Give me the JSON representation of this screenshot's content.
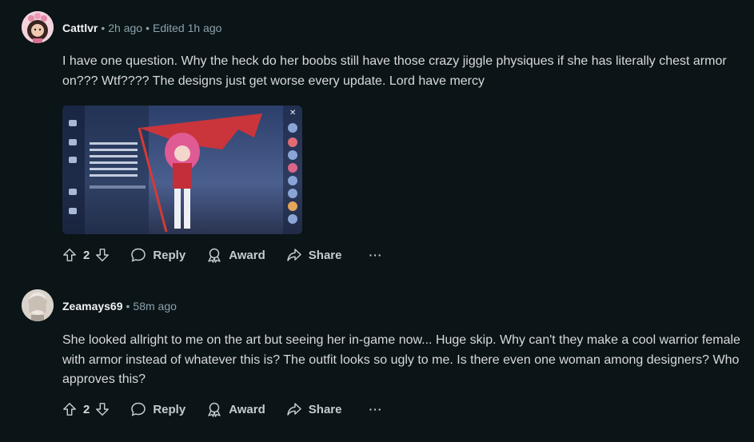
{
  "comments": [
    {
      "author": "Cattlvr",
      "time": "2h ago",
      "edited": "Edited 1h ago",
      "body": "I have one question. Why the heck do her boobs still have those crazy jiggle physiques if she has literally chest armor on??? Wtf???? The designs just get worse every update. Lord have mercy",
      "votes": "2",
      "actions": {
        "reply": "Reply",
        "award": "Award",
        "share": "Share",
        "more": "···"
      }
    },
    {
      "author": "Zeamays69",
      "time": "58m ago",
      "body": "She looked allright to me on the art but seeing her in-game now... Huge skip. Why can't they make a cool warrior female with armor instead of whatever this is? The outfit looks so ugly to me. Is there even one woman among designers? Who approves this?",
      "votes": "2",
      "actions": {
        "reply": "Reply",
        "award": "Award",
        "share": "Share",
        "more": "···"
      }
    }
  ],
  "colors": {
    "background": "#0b1416",
    "text": "#d7dadc",
    "muted": "#8ba2ad"
  }
}
